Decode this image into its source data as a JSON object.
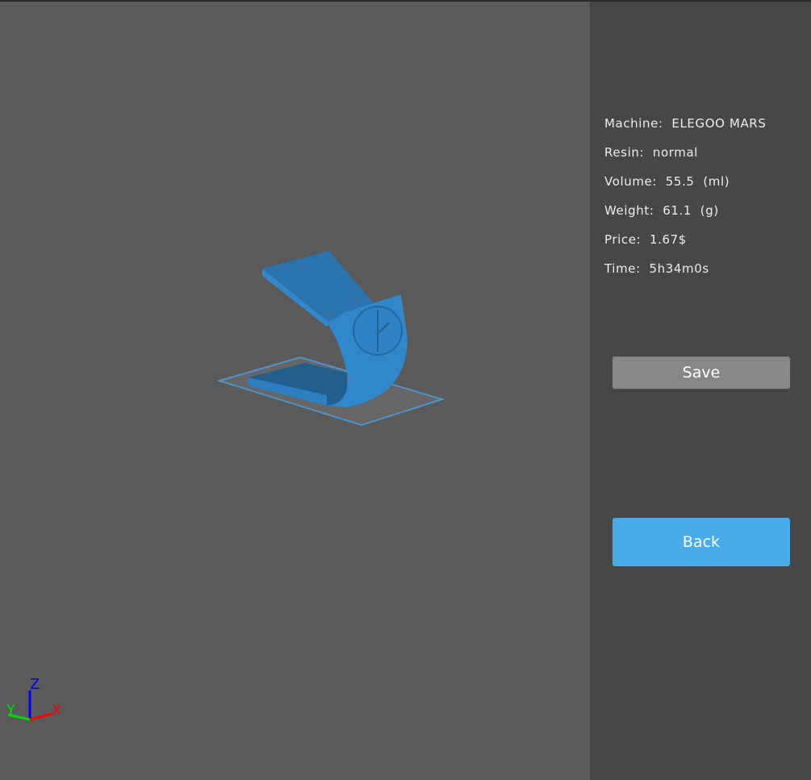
{
  "info": {
    "machine": "Machine:  ELEGOO MARS",
    "resin": "Resin:  normal",
    "volume": "Volume:  55.5  (ml)",
    "weight": "Weight:  61.1  (g)",
    "price": "Price:  1.67$",
    "time": "Time:  5h34m0s"
  },
  "buttons": {
    "save": "Save",
    "back": "Back"
  },
  "axes": {
    "x": "X",
    "y": "Y",
    "z": "Z"
  },
  "colors": {
    "model": "#2e7fc0",
    "accent": "#4aabe9"
  }
}
